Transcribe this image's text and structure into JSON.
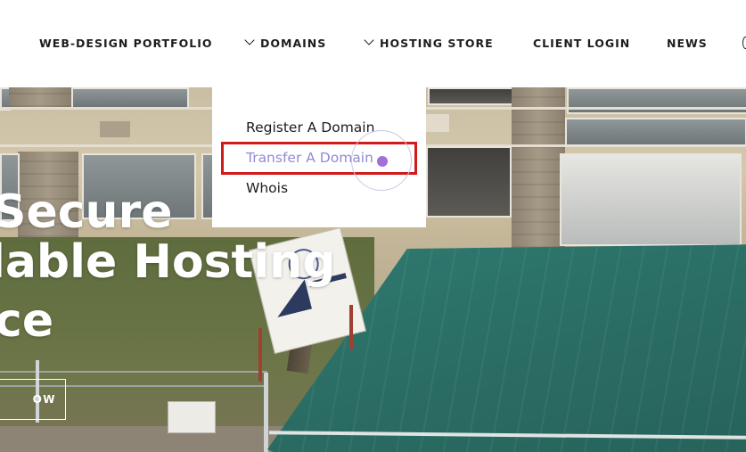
{
  "nav": {
    "items": [
      {
        "label": "WEB-DESIGN PORTFOLIO",
        "has_chevron": false
      },
      {
        "label": "DOMAINS",
        "has_chevron": true
      },
      {
        "label": "HOSTING STORE",
        "has_chevron": true
      },
      {
        "label": "CLIENT LOGIN",
        "has_chevron": false
      },
      {
        "label": "NEWS",
        "has_chevron": false
      }
    ],
    "chevron_icon": "chevron-down-icon"
  },
  "dropdown": {
    "items": [
      {
        "label": "Register A Domain",
        "state": "normal"
      },
      {
        "label": "Transfer A Domain",
        "state": "hover"
      },
      {
        "label": "Whois",
        "state": "normal"
      }
    ]
  },
  "hero": {
    "lines": [
      "Secure",
      "lable Hosting",
      "ce"
    ],
    "button_label": "OW"
  },
  "colors": {
    "nav_text": "#1d1d1d",
    "hover_text": "#8f8cd6",
    "highlight": "#d11a1a",
    "click_dot": "#a070d8",
    "tarp": "#2b6f66"
  }
}
